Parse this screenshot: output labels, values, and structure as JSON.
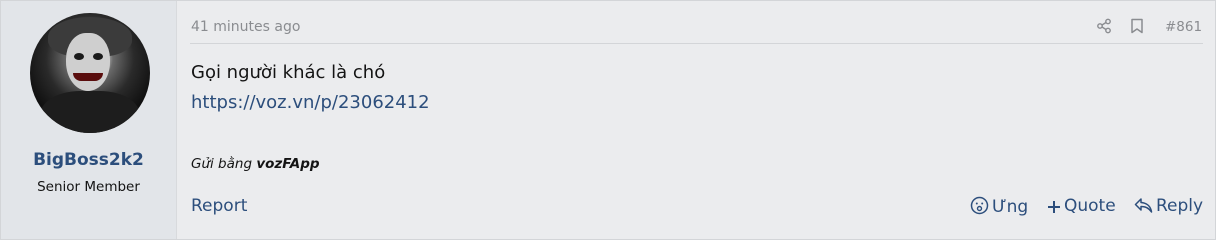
{
  "user": {
    "name": "BigBoss2k2",
    "title": "Senior Member",
    "avatar_icon": "joker-avatar"
  },
  "post": {
    "timestamp": "41 minutes ago",
    "number": "#861",
    "text": "Gọi người khác là chó",
    "link": "https://voz.vn/p/23062412",
    "sent_via_prefix": "Gửi bằng",
    "sent_via_app": "vozFApp"
  },
  "header_icons": [
    "share-icon",
    "bookmark-icon"
  ],
  "footer": {
    "report_label": "Report",
    "like_label": "Ưng",
    "quote_label": "Quote",
    "reply_label": "Reply"
  },
  "colors": {
    "link": "#2c4e7c",
    "muted": "#8a8c90",
    "post_bg": "#ebecee",
    "user_bg": "#e2e5e9"
  }
}
